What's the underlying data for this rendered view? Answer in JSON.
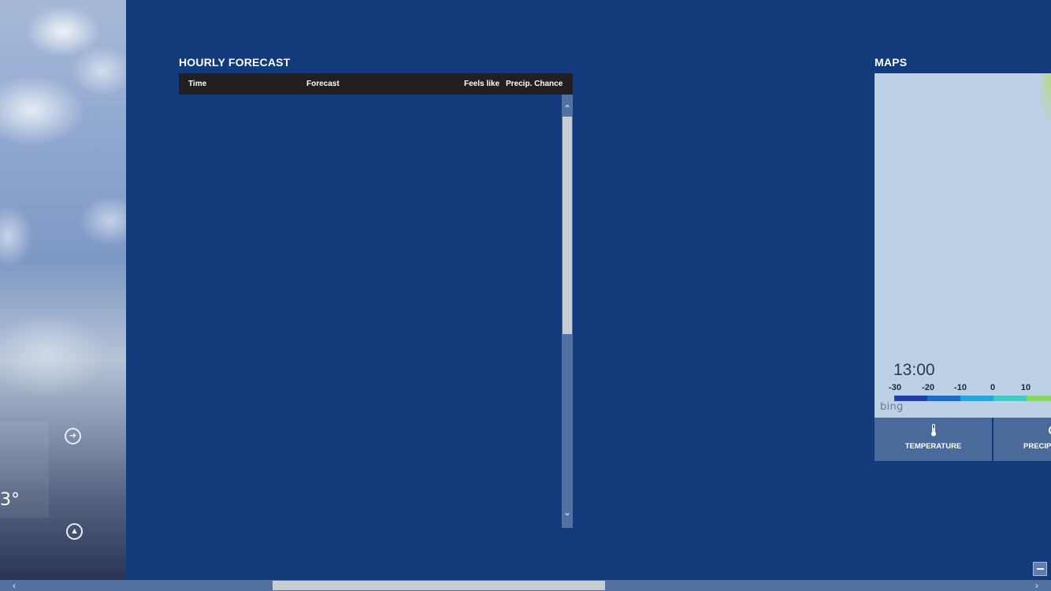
{
  "current": {
    "temperature_fragment": "3°"
  },
  "hourly": {
    "title": "HOURLY FORECAST",
    "columns": [
      "Time",
      "Forecast",
      "Feels like",
      "Precip. Chance"
    ]
  },
  "maps": {
    "title": "MAPS",
    "time": "13:00",
    "scale": [
      {
        "label": "-30",
        "color": "#1e3fa6"
      },
      {
        "label": "-20",
        "color": "#1f6cc4"
      },
      {
        "label": "-10",
        "color": "#2aa6dd"
      },
      {
        "label": "0",
        "color": "#46c9c5"
      },
      {
        "label": "10",
        "color": "#8ad56c"
      }
    ],
    "provider": "bing",
    "tabs": [
      {
        "label": "TEMPERATURE",
        "icon": "thermometer-icon"
      },
      {
        "label": "PRECIPI",
        "icon": "precipitation-icon"
      }
    ]
  },
  "colors": {
    "background": "#133a7a",
    "table_header": "#231f20",
    "map": "#bcd0e6",
    "tab": "#4a6a9c"
  }
}
